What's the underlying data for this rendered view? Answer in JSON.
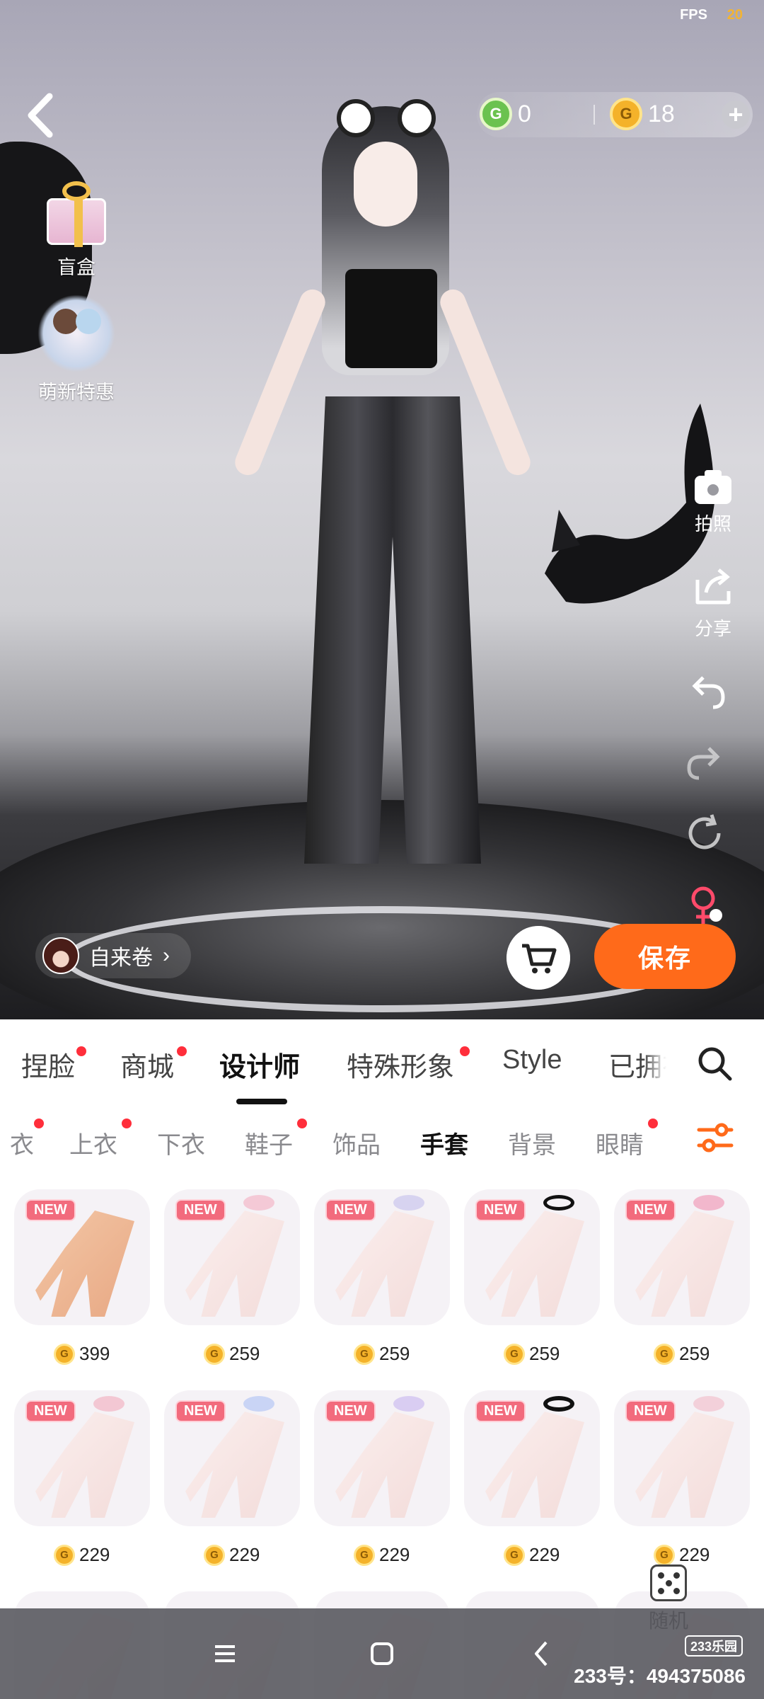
{
  "status": {
    "fps_label": "FPS",
    "fps_value": "20"
  },
  "currency": {
    "green_value": "0",
    "gold_value": "18",
    "coin_glyph": "G"
  },
  "left_side": {
    "blind_box_label": "盲盒",
    "newbie_label": "萌新特惠"
  },
  "right_tools": {
    "photo_label": "拍照",
    "share_label": "分享"
  },
  "creator": {
    "name": "自来卷",
    "chevron": "›"
  },
  "save_label": "保存",
  "main_tabs": [
    "捏脸",
    "商城",
    "设计师",
    "特殊形象",
    "Style",
    "已拥有"
  ],
  "sub_tabs": [
    "衣",
    "上衣",
    "下衣",
    "鞋子",
    "饰品",
    "手套",
    "背景",
    "眼睛"
  ],
  "new_badge": "NEW",
  "items": [
    {
      "price": "399"
    },
    {
      "price": "259"
    },
    {
      "price": "259"
    },
    {
      "price": "259"
    },
    {
      "price": "259"
    },
    {
      "price": "229"
    },
    {
      "price": "229"
    },
    {
      "price": "229"
    },
    {
      "price": "229"
    },
    {
      "price": "229"
    }
  ],
  "random_label": "随机",
  "watermark": {
    "logo": "233乐园",
    "text": "233号：494375086"
  },
  "colors": {
    "accent": "#ff6a1a",
    "badge": "#f26b7d",
    "dot": "#ff2e3b"
  }
}
